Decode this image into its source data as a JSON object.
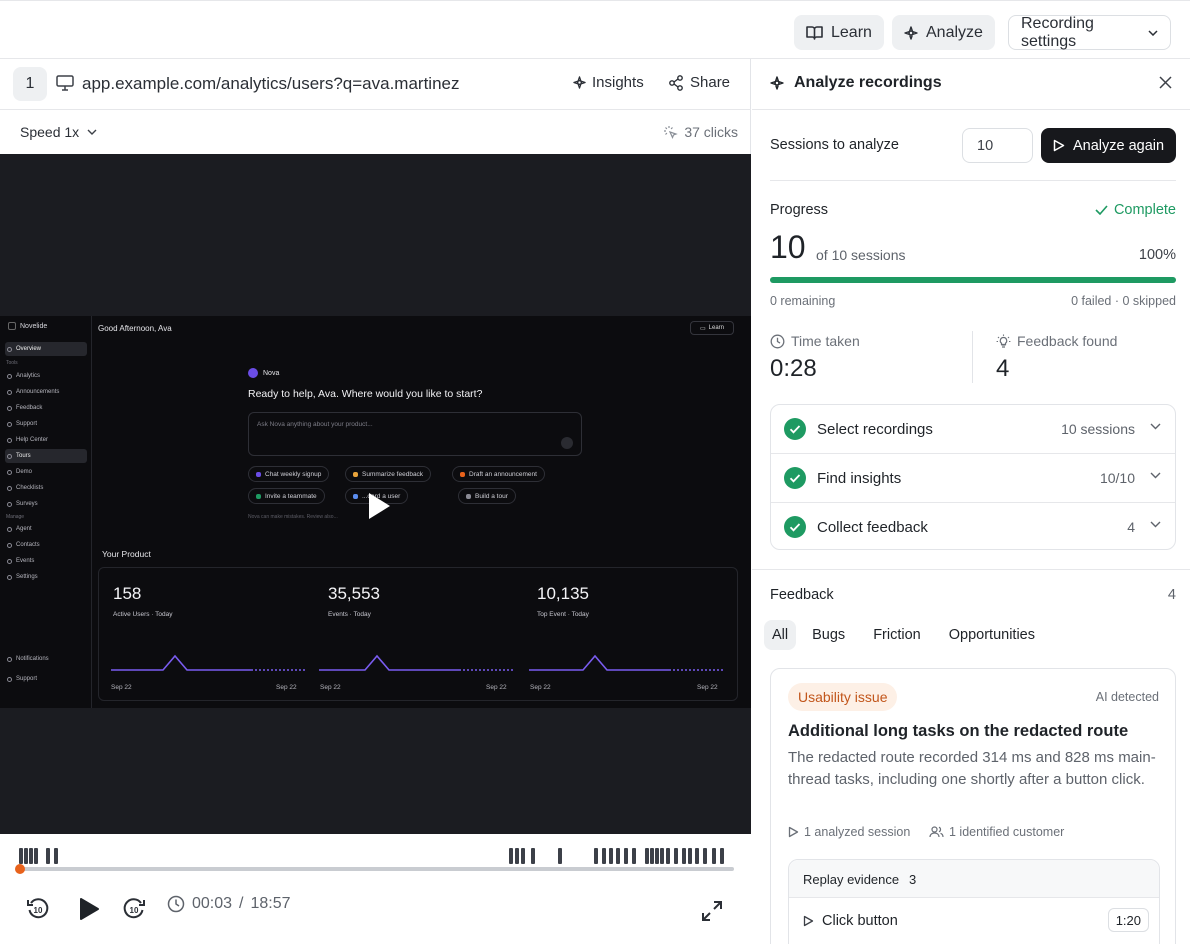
{
  "topbar": {
    "learn_label": "Learn",
    "analyze_label": "Analyze",
    "recording_settings_label": "Recording settings"
  },
  "url_bar": {
    "tab_number": "1",
    "url": "app.example.com/analytics/users?q=ava.martinez",
    "insights_label": "Insights",
    "share_label": "Share"
  },
  "playback": {
    "speed_label": "Speed 1x",
    "clicks_label": "37 clicks",
    "current_time": "00:03",
    "duration": "18:57",
    "time_separator": "/",
    "progress_fraction": 0.003
  },
  "recording": {
    "brand": "Novelide",
    "greeting": "Good Afternoon, Ava",
    "learn_label": "Learn",
    "sidebar_items": [
      {
        "label": "Overview",
        "active": true
      },
      {
        "label": "Analytics"
      },
      {
        "label": "Announcements"
      },
      {
        "label": "Feedback"
      },
      {
        "label": "Support"
      },
      {
        "label": "Help Center"
      },
      {
        "label": "Tours",
        "active": true
      },
      {
        "label": "Demo"
      },
      {
        "label": "Checklists"
      },
      {
        "label": "Surveys"
      },
      {
        "label": "Agent"
      },
      {
        "label": "Contacts"
      },
      {
        "label": "Events"
      },
      {
        "label": "Settings"
      }
    ],
    "sidebar_caption_tools": "Tools",
    "sidebar_caption_manage": "Manage",
    "bottom_items": [
      "Notifications",
      "Support"
    ],
    "assistant_name": "Nova",
    "assistant_heading": "Ready to help, Ava. Where would you like to start?",
    "assistant_placeholder": "Ask Nova anything about your product...",
    "chips": [
      "Chat weekly signup",
      "Summarize feedback",
      "Draft an announcement",
      "Invite a teammate",
      "...oard a user",
      "Build a tour"
    ],
    "disclaimer": "Nova can make mistakes. Review also...",
    "product_heading": "Your Product",
    "metrics": [
      {
        "value": "158",
        "label": "Active Users · Today",
        "start": "Sep 22",
        "end": "Sep 22"
      },
      {
        "value": "35,553",
        "label": "Events · Today",
        "start": "Sep 22",
        "end": "Sep 22"
      },
      {
        "value": "10,135",
        "label": "Top Event · Today",
        "start": "Sep 22",
        "end": "Sep 22"
      }
    ]
  },
  "panel": {
    "title": "Analyze recordings",
    "sessions_label": "Sessions to analyze",
    "sessions_value": "10",
    "analyze_again_label": "Analyze again",
    "progress_label": "Progress",
    "status_label": "Complete",
    "completed_count": "10",
    "completed_of": "of 10 sessions",
    "percent_label": "100%",
    "progress_fraction": 1.0,
    "remaining_label": "0 remaining",
    "failed_skipped_label": "0 failed · 0 skipped",
    "time_taken_label": "Time taken",
    "time_taken_value": "0:28",
    "feedback_found_label": "Feedback found",
    "feedback_found_value": "4",
    "steps": [
      {
        "name": "Select recordings",
        "value": "10 sessions"
      },
      {
        "name": "Find insights",
        "value": "10/10"
      },
      {
        "name": "Collect feedback",
        "value": "4"
      }
    ],
    "feedback_label": "Feedback",
    "feedback_count": "4",
    "tabs": [
      "All",
      "Bugs",
      "Friction",
      "Opportunities"
    ],
    "card": {
      "badge": "Usability issue",
      "source": "AI detected",
      "title": "Additional long tasks on the redacted route",
      "body": "The redacted route recorded 314 ms and 828 ms main-thread tasks, including one shortly after a button click.",
      "sessions_meta": "1 analyzed session",
      "customers_meta": "1 identified customer",
      "evidence_label": "Replay evidence",
      "evidence_count": "3",
      "evidence_item": "Click button",
      "evidence_time": "1:20"
    }
  },
  "colors": {
    "accent_green": "#1e9a62",
    "seek_orange": "#e8621b",
    "badge_orange": "#c2561b",
    "dark_button": "#17181c",
    "nova_purple": "#6b4de6"
  }
}
